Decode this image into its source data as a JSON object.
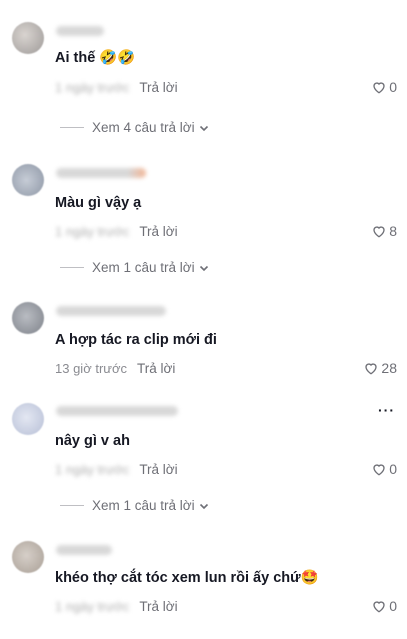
{
  "comments": [
    {
      "text": "Ai thế 🤣🤣",
      "time": "1 ngày trước",
      "time_blurred": true,
      "reply_label": "Trả lời",
      "likes": "0",
      "view_replies": "Xem 4 câu trả lời"
    },
    {
      "text": "Màu gì vậy ạ",
      "time": "1 ngày trước",
      "time_blurred": true,
      "reply_label": "Trả lời",
      "likes": "8",
      "view_replies": "Xem 1 câu trả lời"
    },
    {
      "text": "A hợp tác ra clip mới đi",
      "time": "13 giờ trước",
      "time_blurred": false,
      "reply_label": "Trả lời",
      "likes": "28",
      "view_replies": ""
    },
    {
      "text": "nây gì v ah",
      "time": "1 ngày trước",
      "time_blurred": true,
      "reply_label": "Trả lời",
      "likes": "0",
      "view_replies": "Xem 1 câu trả lời",
      "more": "···"
    },
    {
      "text": "khéo thợ cắt tóc xem lun rồi ấy chứ🤩",
      "time": "1 ngày trước",
      "time_blurred": true,
      "reply_label": "Trả lời",
      "likes": "0",
      "view_replies": ""
    }
  ],
  "icons": {
    "like": "heart-outline-icon",
    "expand": "chevron-down-icon",
    "more": "more-dots-icon"
  }
}
